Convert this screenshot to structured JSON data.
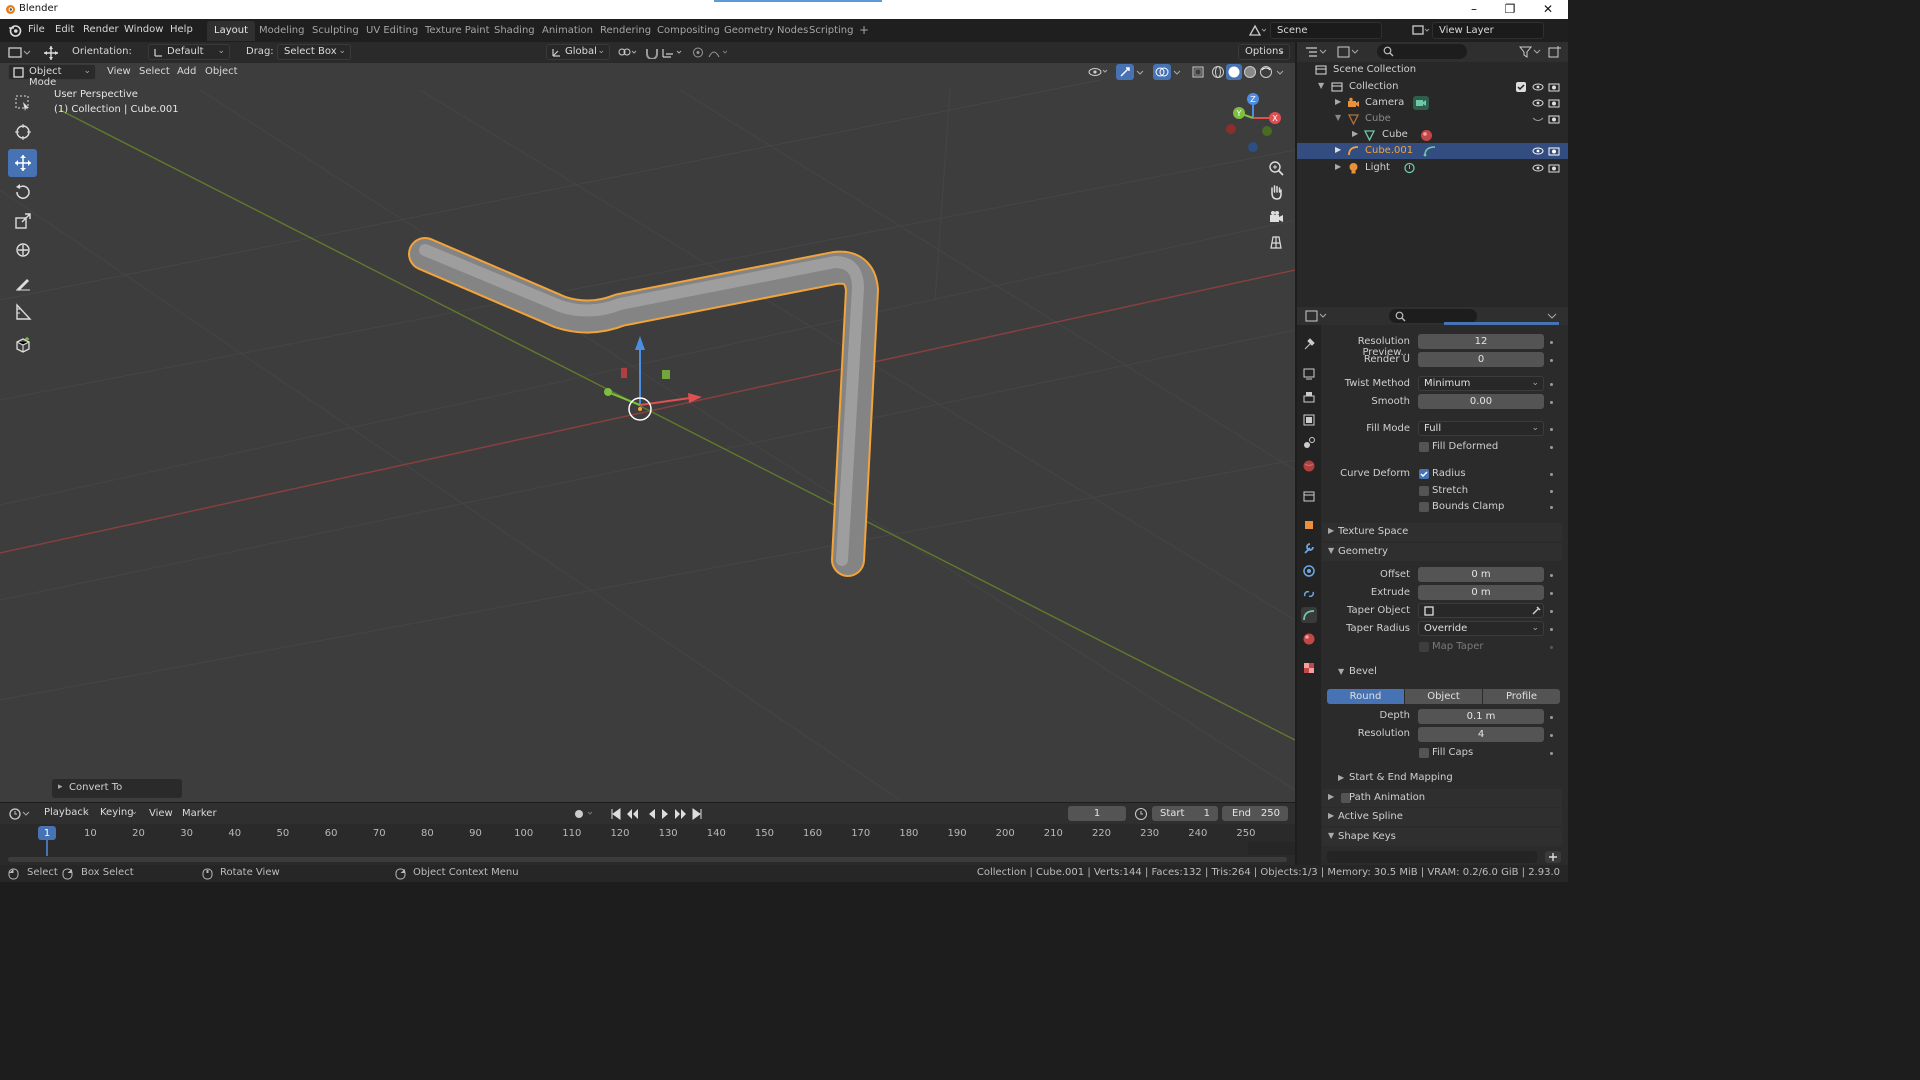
{
  "window": {
    "title": "Blender",
    "controls": [
      "–",
      "❐",
      "✕"
    ]
  },
  "menu": [
    "File",
    "Edit",
    "Render",
    "Window",
    "Help"
  ],
  "workspaces": [
    {
      "label": "Layout",
      "active": true
    },
    {
      "label": "Modeling"
    },
    {
      "label": "Sculpting"
    },
    {
      "label": "UV Editing"
    },
    {
      "label": "Texture Paint"
    },
    {
      "label": "Shading"
    },
    {
      "label": "Animation"
    },
    {
      "label": "Rendering"
    },
    {
      "label": "Compositing"
    },
    {
      "label": "Geometry Nodes"
    },
    {
      "label": "Scripting"
    },
    {
      "label": "+"
    }
  ],
  "scene": {
    "name": "Scene",
    "view_layer": "View Layer"
  },
  "tool_header": {
    "orientation_label": "Orientation:",
    "orientation_value": "Default",
    "drag_label": "Drag:",
    "drag_value": "Select Box",
    "transform_space": "Global",
    "options": "Options"
  },
  "viewport_header": {
    "mode": "Object Mode",
    "menus": [
      "View",
      "Select",
      "Add",
      "Object"
    ]
  },
  "viewport": {
    "perspective": "User Perspective",
    "context": "(1) Collection | Cube.001",
    "last_op": "Convert To",
    "gizmo_axes": [
      "X",
      "Y",
      "Z"
    ]
  },
  "outliner": {
    "rows": [
      {
        "label": "Scene Collection"
      },
      {
        "label": "Collection"
      },
      {
        "label": "Camera"
      },
      {
        "label": "Cube"
      },
      {
        "label": "Cube"
      },
      {
        "label": "Cube.001",
        "selected": true
      },
      {
        "label": "Light"
      }
    ]
  },
  "properties": {
    "resolution_preview_label": "Resolution Preview...",
    "resolution_preview": "12",
    "render_u_label": "Render U",
    "render_u": "0",
    "twist_method_label": "Twist Method",
    "twist_method": "Minimum",
    "smooth_label": "Smooth",
    "smooth": "0.00",
    "fill_mode_label": "Fill Mode",
    "fill_mode": "Full",
    "fill_deformed": "Fill Deformed",
    "curve_deform_label": "Curve Deform",
    "radius": "Radius",
    "stretch": "Stretch",
    "bounds_clamp": "Bounds Clamp",
    "texture_space": "Texture Space",
    "geometry": "Geometry",
    "offset_label": "Offset",
    "offset": "0 m",
    "extrude_label": "Extrude",
    "extrude": "0 m",
    "taper_object_label": "Taper Object",
    "taper_radius_label": "Taper Radius",
    "taper_radius": "Override",
    "map_taper": "Map Taper",
    "bevel": "Bevel",
    "bevel_modes": [
      "Round",
      "Object",
      "Profile"
    ],
    "depth_label": "Depth",
    "depth": "0.1 m",
    "resolution_label": "Resolution",
    "resolution": "4",
    "fill_caps": "Fill Caps",
    "start_end_mapping": "Start & End Mapping",
    "path_animation": "Path Animation",
    "active_spline": "Active Spline",
    "shape_keys": "Shape Keys"
  },
  "timeline": {
    "menus": [
      "Playback",
      "Keying",
      "View",
      "Marker"
    ],
    "current_frame": "1",
    "start_label": "Start",
    "start": "1",
    "end_label": "End",
    "end": "250",
    "ticks": [
      "1",
      "10",
      "20",
      "30",
      "40",
      "50",
      "60",
      "70",
      "80",
      "90",
      "100",
      "110",
      "120",
      "130",
      "140",
      "150",
      "160",
      "170",
      "180",
      "190",
      "200",
      "210",
      "220",
      "230",
      "240",
      "250"
    ]
  },
  "statusbar": {
    "select": "Select",
    "box_select": "Box Select",
    "rotate_view": "Rotate View",
    "context_menu": "Object Context Menu",
    "stats": "Collection | Cube.001 | Verts:144 | Faces:132 | Tris:264 | Objects:1/3 | Memory: 30.5 MiB | VRAM: 0.2/6.0 GiB | 2.93.0"
  },
  "colors": {
    "accent": "#4772b3",
    "selection_outline": "#f5a623",
    "axis_x": "#c84a4a",
    "axis_y": "#7ea33a",
    "viewport_bg": "#3d3d3d"
  }
}
